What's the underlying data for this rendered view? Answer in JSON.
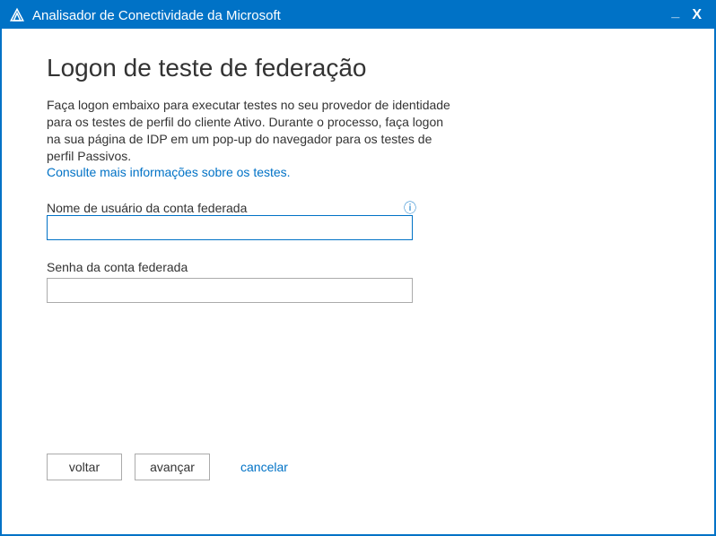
{
  "window": {
    "title": "Analisador de Conectividade da Microsoft"
  },
  "page": {
    "heading": "Logon de teste de federação",
    "description": "Faça logon embaixo para executar testes no seu provedor de identidade para os testes de perfil do cliente Ativo. Durante o processo, faça logon na sua página de IDP em um pop-up do navegador para os testes de perfil Passivos.",
    "help_link": "Consulte mais informações sobre os testes."
  },
  "form": {
    "username_label": "Nome de usuário da conta federada",
    "username_value": "",
    "password_label": "Senha da conta federada",
    "password_value": ""
  },
  "buttons": {
    "back": "voltar",
    "next": "avançar",
    "cancel": "cancelar"
  },
  "icons": {
    "info_glyph": "ⓘ"
  }
}
